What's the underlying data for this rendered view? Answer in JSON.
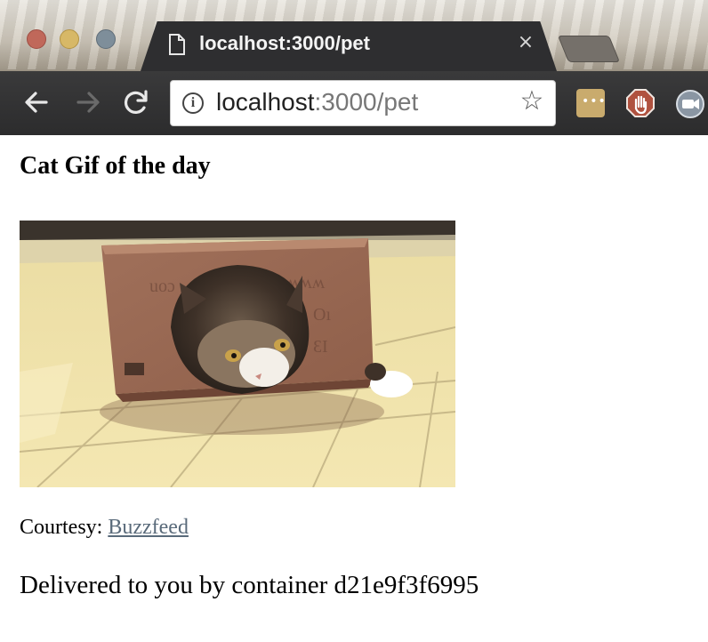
{
  "browser": {
    "tab_title": "localhost:3000/pet",
    "close_glyph": "×",
    "url_host": "localhost",
    "url_rest": ":3000/pet",
    "icons": {
      "back": "back-arrow-icon",
      "forward": "forward-arrow-icon",
      "reload": "reload-icon",
      "info": "info-icon",
      "bookmark": "star-icon",
      "page": "page-icon"
    },
    "extensions": [
      "more-extension-icon",
      "stop-hand-extension-icon",
      "camera-extension-icon"
    ],
    "colors": {
      "tab": "#2e2e30",
      "toolbar": "#333334"
    }
  },
  "page": {
    "title": "Cat Gif of the day",
    "image_subject": "cat-in-cardboard-box",
    "courtesy_label": "Courtesy:",
    "courtesy_link": "Buzzfeed",
    "delivered_text": "Delivered to you by container d21e9f3f6995",
    "colors": {
      "link": "#596a7a",
      "text": "#000000"
    }
  }
}
